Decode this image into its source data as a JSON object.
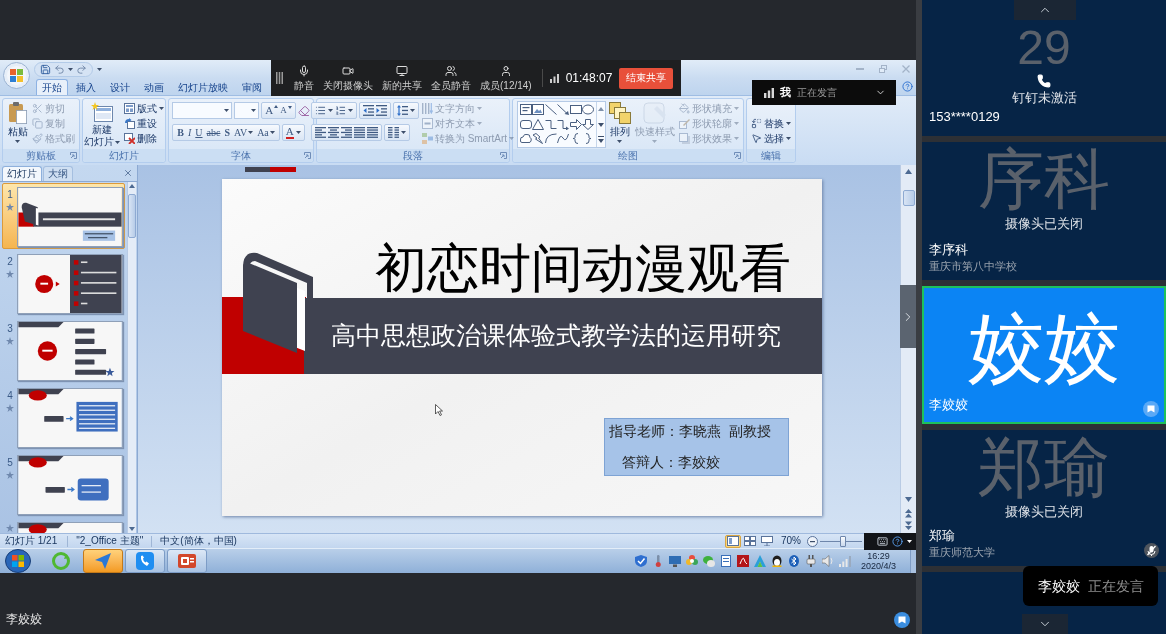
{
  "meeting_toolbar": {
    "buttons": [
      {
        "label": "静音"
      },
      {
        "label": "关闭摄像头"
      },
      {
        "label": "新的共享"
      },
      {
        "label": "全员静音"
      },
      {
        "label": "成员(12/14)"
      }
    ],
    "timer": "01:48:07",
    "end_button": "结束共享"
  },
  "speaker_banner": {
    "name": "我",
    "status": "正在发言"
  },
  "ppt": {
    "ribbon_tabs": [
      {
        "label": "开始",
        "selected": true
      },
      {
        "label": "插入",
        "selected": false
      },
      {
        "label": "设计",
        "selected": false
      },
      {
        "label": "动画",
        "selected": false
      },
      {
        "label": "幻灯片放映",
        "selected": false
      },
      {
        "label": "审阅",
        "selected": false
      }
    ],
    "ribbon_groups": [
      {
        "kind": "clipboard",
        "label": "剪贴板",
        "launcher": true,
        "large": [
          {
            "lines": [
              "粘贴"
            ],
            "disabled": false
          }
        ],
        "small": [
          {
            "label": "剪切",
            "disabled": true
          },
          {
            "label": "复制",
            "disabled": true
          },
          {
            "label": "格式刷",
            "disabled": true
          }
        ]
      },
      {
        "kind": "slides",
        "label": "幻灯片",
        "launcher": false,
        "large": [
          {
            "lines": [
              "新建",
              "幻灯片"
            ],
            "disabled": false
          }
        ],
        "small": [
          {
            "label": "版式",
            "disabled": false
          },
          {
            "label": "重设",
            "disabled": false
          },
          {
            "label": "删除",
            "disabled": false
          }
        ]
      },
      {
        "kind": "font",
        "label": "字体",
        "launcher": true,
        "size_buttons": [
          "A",
          "A"
        ],
        "format_buttons": [
          "B",
          "I",
          "U",
          "abc",
          "S",
          "AV",
          "Aa",
          "A"
        ]
      },
      {
        "kind": "paragraph",
        "label": "段落",
        "launcher": true,
        "small": [
          {
            "label": "文字方向",
            "disabled": true
          },
          {
            "label": "对齐文本",
            "disabled": true
          },
          {
            "label": "转换为 SmartArt",
            "disabled": true
          }
        ]
      },
      {
        "kind": "drawing",
        "label": "绘图",
        "launcher": true,
        "large": [
          {
            "lines": [
              "排列"
            ],
            "disabled": false
          },
          {
            "lines": [
              "快速样式"
            ],
            "disabled": true
          }
        ],
        "small": [
          {
            "label": "形状填充",
            "disabled": true
          },
          {
            "label": "形状轮廓",
            "disabled": true
          },
          {
            "label": "形状效果",
            "disabled": true
          }
        ]
      },
      {
        "kind": "editing",
        "label": "编辑",
        "launcher": false,
        "small": [
          {
            "label": "替换",
            "disabled": false
          },
          {
            "label": "选择",
            "disabled": false
          }
        ]
      }
    ],
    "slide_pane": {
      "tabs": [
        {
          "label": "幻灯片",
          "selected": true
        },
        {
          "label": "大纲",
          "selected": false
        }
      ],
      "slides": [
        {
          "number": "1",
          "kind": "title",
          "selected": true
        },
        {
          "number": "2",
          "kind": "agenda",
          "selected": false
        },
        {
          "number": "3",
          "kind": "list",
          "selected": false
        },
        {
          "number": "4",
          "kind": "text",
          "selected": false
        },
        {
          "number": "5",
          "kind": "diagram",
          "selected": false
        },
        {
          "kind": "banner",
          "selected": false
        }
      ]
    },
    "slide": {
      "title": "初恋时间动漫观看",
      "subtitle": "高中思想政治课体验式教学法的运用研究",
      "credits": [
        "指导老师：李晓燕  副教授",
        "答辩人：李姣姣"
      ]
    },
    "status_bar": {
      "slide_position": "幻灯片 1/21",
      "theme": "\"2_Office 主题\"",
      "language": "中文(简体，中国)",
      "views": [
        {
          "selected": true
        },
        {
          "selected": false
        },
        {
          "selected": false
        }
      ],
      "zoom": "70%",
      "zoom_slider": {
        "level": 0.55
      }
    }
  },
  "taskbar": {
    "apps": [
      {
        "running": false,
        "highlighted": false
      },
      {
        "running": true,
        "highlighted": true
      },
      {
        "running": true,
        "highlighted": false
      },
      {
        "running": true,
        "highlighted": false
      }
    ],
    "time": "16:29",
    "date": "2020/4/3"
  },
  "presenter_label": "李姣姣",
  "participants": [
    {
      "kind": "phone",
      "avatar": "29",
      "status": "钉钉未激活",
      "name": "153****0129",
      "speaking": false,
      "muted": false,
      "sharing": false
    },
    {
      "kind": "camera_off",
      "avatar": "序科",
      "status": "摄像头已关闭",
      "name": "李序科",
      "org": "重庆市第八中学校",
      "speaking": false,
      "muted": false,
      "sharing": false
    },
    {
      "kind": "avatar",
      "avatar": "姣姣",
      "name": "李姣姣",
      "speaking": true,
      "muted": false,
      "sharing": true
    },
    {
      "kind": "camera_off",
      "avatar": "郑瑜",
      "status": "摄像头已关闭",
      "name": "郑瑜",
      "org": "重庆师范大学",
      "speaking": false,
      "muted": true,
      "sharing": false
    },
    {
      "kind": "blank",
      "speaking": false,
      "muted": false,
      "sharing": false
    }
  ],
  "speaking_toast": {
    "name": "李姣姣",
    "status": "正在发言"
  }
}
